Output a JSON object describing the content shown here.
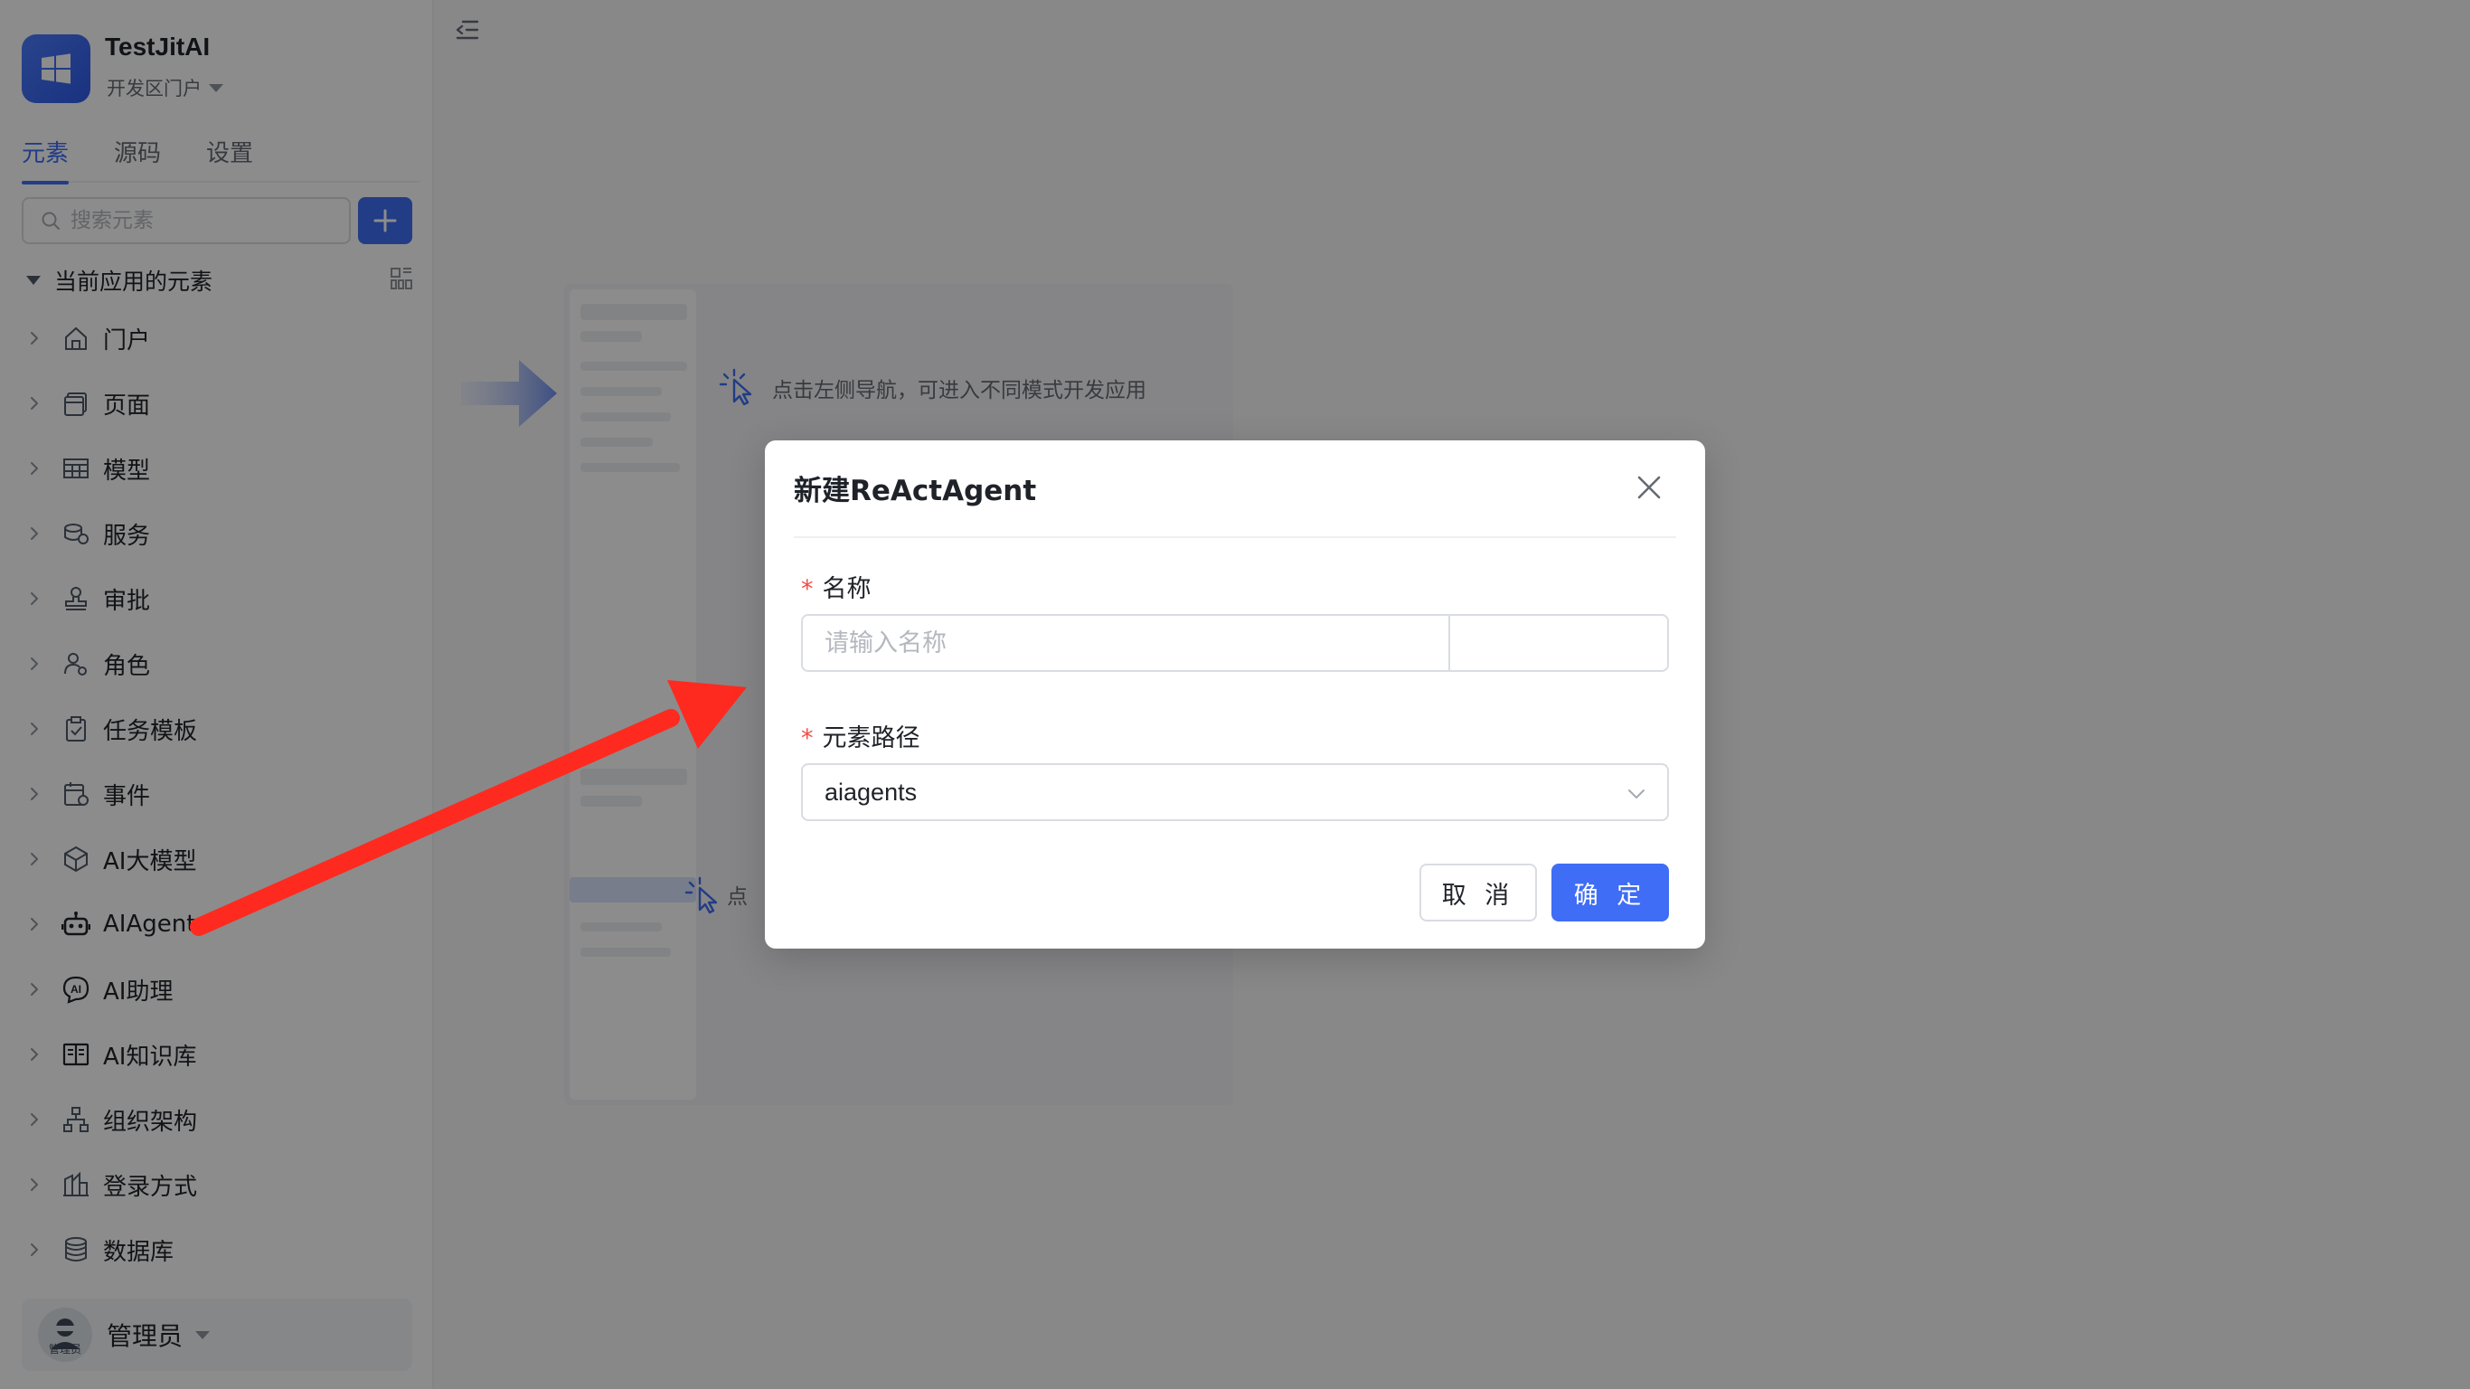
{
  "app": {
    "name": "TestJitAI",
    "portal": "开发区门户"
  },
  "tabs": [
    {
      "label": "元素"
    },
    {
      "label": "源码"
    },
    {
      "label": "设置"
    }
  ],
  "search": {
    "placeholder": "搜索元素"
  },
  "section": {
    "title": "当前应用的元素"
  },
  "tree": [
    {
      "label": "门户",
      "icon": "home-icon"
    },
    {
      "label": "页面",
      "icon": "page-icon"
    },
    {
      "label": "模型",
      "icon": "table-icon"
    },
    {
      "label": "服务",
      "icon": "service-icon"
    },
    {
      "label": "审批",
      "icon": "stamp-icon"
    },
    {
      "label": "角色",
      "icon": "role-icon"
    },
    {
      "label": "任务模板",
      "icon": "clipboard-icon"
    },
    {
      "label": "事件",
      "icon": "calendar-icon"
    },
    {
      "label": "AI大模型",
      "icon": "cube-icon"
    },
    {
      "label": "AIAgent",
      "icon": "robot-icon"
    },
    {
      "label": "AI助理",
      "icon": "ai-assistant-icon"
    },
    {
      "label": "AI知识库",
      "icon": "book-icon"
    },
    {
      "label": "组织架构",
      "icon": "org-chart-icon"
    },
    {
      "label": "登录方式",
      "icon": "building-icon"
    },
    {
      "label": "数据库",
      "icon": "database-icon"
    }
  ],
  "user": {
    "name": "管理员",
    "avatar_text": "管理员"
  },
  "canvas": {
    "hint": "点击左侧导航，可进入不同模式开发应用",
    "hint_partial": "点"
  },
  "modal": {
    "title": "新建ReActAgent",
    "name_label": "名称",
    "name_placeholder": "请输入名称",
    "path_label": "元素路径",
    "path_value": "aiagents",
    "cancel_label": "取 消",
    "ok_label": "确 定"
  },
  "colors": {
    "accent": "#3f6df5",
    "required": "#f54a45",
    "annotation_arrow": "#ff2a1f"
  }
}
